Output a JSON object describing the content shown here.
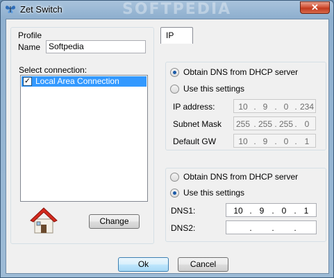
{
  "window": {
    "title": "Zet Switch",
    "watermark": "SOFTPEDIA",
    "close_glyph": "✕"
  },
  "profile": {
    "caption": "Profile",
    "name_label": "Name",
    "name_value": "Softpedia",
    "select_label": "Select connection:",
    "connections": [
      {
        "label": "Local Area Connection",
        "checked": true,
        "selected": true
      }
    ],
    "change_label": "Change"
  },
  "tabs": [
    {
      "label": "IP",
      "active": true
    }
  ],
  "ip_group": {
    "radio_dhcp": "Obtain DNS from DHCP server",
    "radio_manual": "Use this settings",
    "selected": "dhcp",
    "ip_label": "IP address:",
    "ip_value": [
      "10",
      "9",
      "0",
      "234"
    ],
    "mask_label": "Subnet Mask",
    "mask_value": [
      "255",
      "255",
      "255",
      "0"
    ],
    "gw_label": "Default GW",
    "gw_value": [
      "10",
      "9",
      "0",
      "1"
    ]
  },
  "dns_group": {
    "radio_dhcp": "Obtain DNS from DHCP server",
    "radio_manual": "Use this settings",
    "selected": "manual",
    "dns1_label": "DNS1:",
    "dns1_value": [
      "10",
      "9",
      "0",
      "1"
    ],
    "dns2_label": "DNS2:",
    "dns2_value": [
      "",
      "",
      "",
      ""
    ]
  },
  "buttons": {
    "ok": "Ok",
    "cancel": "Cancel"
  },
  "icons": {
    "app": "butterfly-icon",
    "home": "home-icon",
    "check": "✓"
  },
  "colors": {
    "selection": "#3399ff",
    "close": "#c03a1e"
  }
}
